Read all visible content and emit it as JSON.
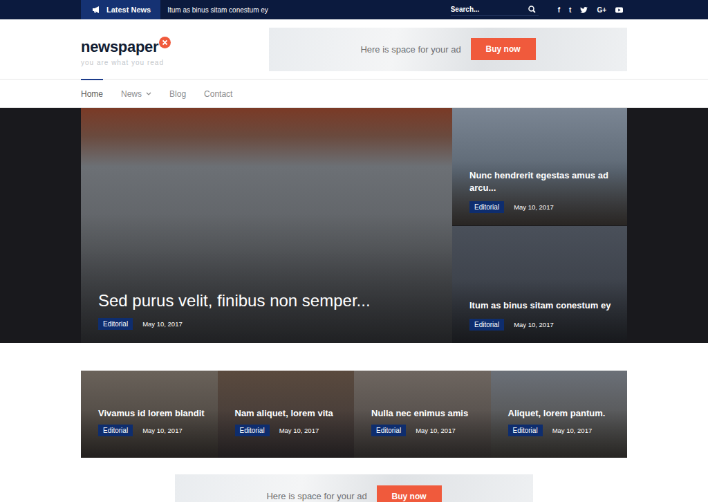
{
  "topbar": {
    "latest_label": "Latest News",
    "ticker": "Itum as binus sitam conestum ey",
    "search": {
      "placeholder": "Search..."
    },
    "social": [
      {
        "kind": "glyph",
        "text": "f"
      },
      {
        "kind": "glyph",
        "text": "t"
      },
      {
        "kind": "twitter",
        "text": ""
      },
      {
        "kind": "glyph",
        "text": "G+"
      },
      {
        "kind": "youtube",
        "text": ""
      }
    ]
  },
  "header": {
    "logo": "newspaper",
    "tagline": "you are what you read",
    "ad": {
      "text": "Here is space for your ad",
      "button": "Buy now"
    }
  },
  "nav": [
    {
      "label": "Home",
      "selected": true,
      "dropdown": false
    },
    {
      "label": "News",
      "selected": false,
      "dropdown": true
    },
    {
      "label": "Blog",
      "selected": false,
      "dropdown": false
    },
    {
      "label": "Contact",
      "selected": false,
      "dropdown": false
    }
  ],
  "featured": {
    "main": {
      "title": "Sed purus velit, finibus non semper...",
      "category": "Editorial",
      "date": "May 10, 2017"
    },
    "side": [
      {
        "title": "Nunc hendrerit egestas amus ad arcu...",
        "category": "Editorial",
        "date": "May 10, 2017"
      },
      {
        "title": "Itum as binus sitam conestum ey",
        "category": "Editorial",
        "date": "May 10, 2017"
      }
    ]
  },
  "cards": [
    {
      "title": "Vivamus id lorem blandit",
      "category": "Editorial",
      "date": "May 10, 2017"
    },
    {
      "title": "Nam aliquet, lorem vita",
      "category": "Editorial",
      "date": "May 10, 2017"
    },
    {
      "title": "Nulla nec enimus amis",
      "category": "Editorial",
      "date": "May 10, 2017"
    },
    {
      "title": "Aliquet, lorem pantum.",
      "category": "Editorial",
      "date": "May 10, 2017"
    }
  ],
  "bottom_ad": {
    "text": "Here is space for your ad",
    "button": "Buy now"
  }
}
